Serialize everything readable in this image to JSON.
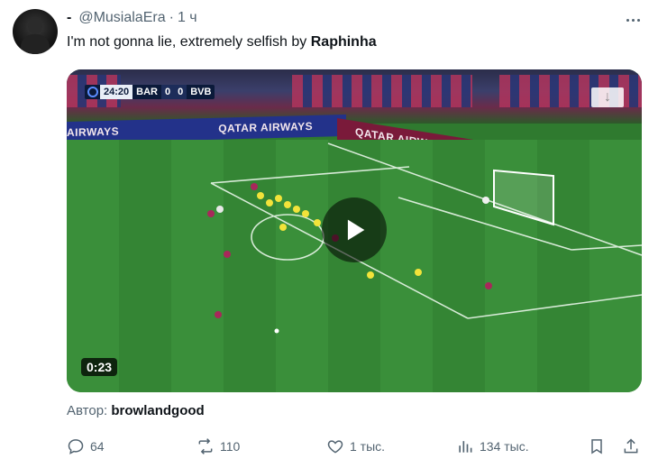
{
  "tweet": {
    "username": "@MusialaEra",
    "separator": "·",
    "time": "1 ч",
    "text_before": "I'm not gonna lie, extremely selfish by ",
    "text_bold": "Raphinha"
  },
  "video": {
    "duration": "0:23",
    "scoreboard": {
      "time": "24:20",
      "home": "BAR",
      "home_score": "0",
      "away_score": "0",
      "away": "BVB"
    },
    "adboards": [
      "QATAR AIRWAYS",
      "QATAR AIRWAYS"
    ],
    "adboard_partial": "AIRWAYS"
  },
  "author": {
    "label": "Автор:",
    "name": "browlandgood"
  },
  "actions": {
    "replies": "64",
    "reposts": "110",
    "likes": "1 тыс.",
    "views": "134 тыс."
  },
  "colors": {
    "text_primary": "#0f1419",
    "text_secondary": "#536471",
    "pitch": "#3a8f3a"
  }
}
